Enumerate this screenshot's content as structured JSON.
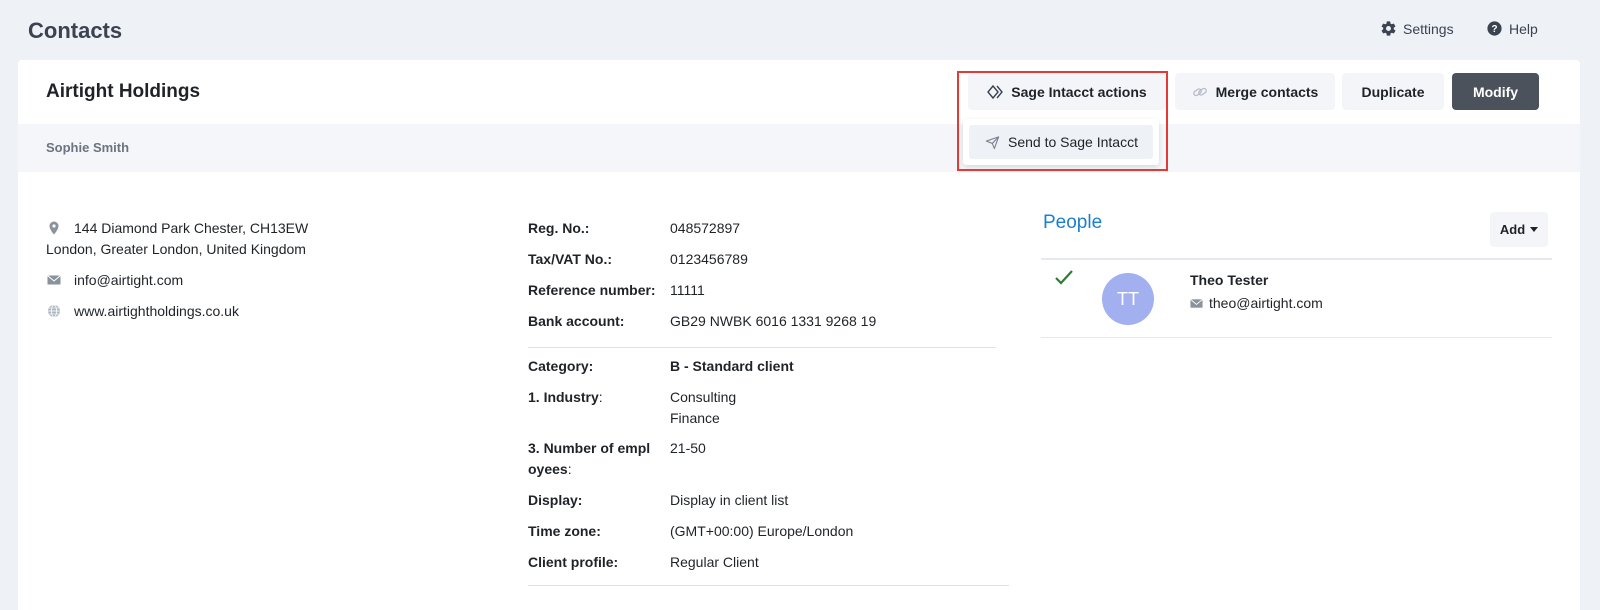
{
  "header": {
    "title": "Contacts",
    "settings_label": "Settings",
    "help_label": "Help"
  },
  "contact": {
    "name": "Airtight Holdings",
    "owner": "Sophie Smith"
  },
  "actions": {
    "sage_label": "Sage Intacct actions",
    "merge_label": "Merge contacts",
    "duplicate_label": "Duplicate",
    "modify_label": "Modify"
  },
  "dropdown": {
    "send_label": "Send to Sage Intacct"
  },
  "address": {
    "line1": "144 Diamond Park Chester, CH13EW",
    "line2": "London, Greater London, United Kingdom",
    "email": "info@airtight.com",
    "website": "www.airtightholdings.co.uk"
  },
  "details": {
    "reg_label": "Reg. No.:",
    "reg_value": "048572897",
    "tax_label": "Tax/VAT No.:",
    "tax_value": "0123456789",
    "ref_label": "Reference number:",
    "ref_value": "11111",
    "bank_label": "Bank account:",
    "bank_value": "GB29 NWBK 6016 1331 9268 19",
    "category_label": "Category:",
    "category_value": "B - Standard client",
    "industry_label": "1. Industry",
    "industry_value1": "Consulting",
    "industry_value2": "Finance",
    "employees_label1": "3. Number of empl",
    "employees_label2": "oyees",
    "employees_value": "21-50",
    "display_label": "Display:",
    "display_value": "Display in client list",
    "timezone_label": "Time zone:",
    "timezone_value": "(GMT+00:00) Europe/London",
    "profile_label": "Client profile:",
    "profile_value": "Regular Client"
  },
  "people": {
    "title": "People",
    "add_label": "Add",
    "items": [
      {
        "initials": "TT",
        "name": "Theo Tester",
        "email": "theo@airtight.com"
      }
    ]
  },
  "colors": {
    "accent": "#1d7fd0",
    "modify_bg": "#4b525b",
    "highlight": "#e53935",
    "avatar_bg": "#a3b0ef",
    "check": "#2e7d32"
  }
}
